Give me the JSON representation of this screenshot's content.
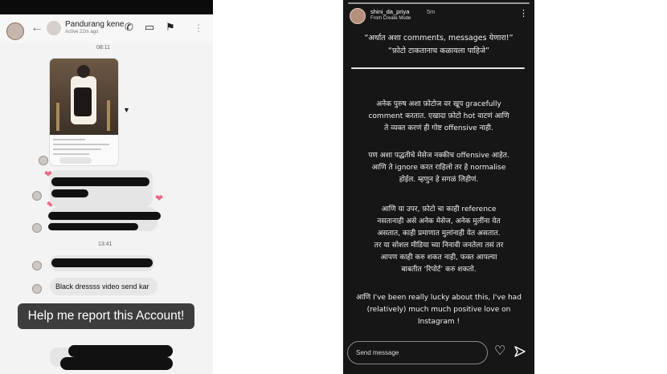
{
  "left_story": {
    "contact_name": "Pandurang kene",
    "contact_status": "Active 22m ago",
    "timestamps": [
      "08:11",
      "13:41"
    ],
    "last_message": "Black dressss video send kar",
    "report_banner": "Help me report this Account!",
    "icons": [
      "back-arrow-icon",
      "phone-icon",
      "video-icon",
      "flag-icon",
      "more-icon"
    ]
  },
  "right_story": {
    "username": "shini_da_priya",
    "time_ago": "5m",
    "subtitle": "From Create Mode",
    "quote": "“अर्थात अशा comments, messages येणारा!”\n“फ़ोटो टाकतानाच कळायला पाहिजे”",
    "paragraph_1": "अनेक पुरुष अशा फ़ोटोज वर खूप gracefully\ncomment करतात. एखादा फ़ोटो hot वाटणं आणि\nते व्यक्त करणं ही गोष्ट offensive नाही.",
    "paragraph_2": "पण अशा पद्धतीचे मेसेज नक्कीच offensive आहेत.\nआणि ते ignore करत राहिलो तर हे normalise\nहोईल. म्हणुन हे सगळं लिहीणं.",
    "paragraph_3": "आणि या उपर, फ़ोटो चा काही reference\nनसतानाही असे अनेक मेसेज, अनेक मुलींना येत\nअसतात, काही प्रमाणात मुलांनाही येत असतात.\nतर या सोशल मीडिया च्या निनावी जनतेला तसं तर\nआपण काही करु शकत नाही, फक्त आपल्या\nबाबतीत ‘रिपोर्ट’ करु शकतो.",
    "paragraph_4": "आणि I've been really lucky about this, I've had\n(relatively) much much positive love on Instagram !",
    "reply_placeholder": "Send message"
  }
}
